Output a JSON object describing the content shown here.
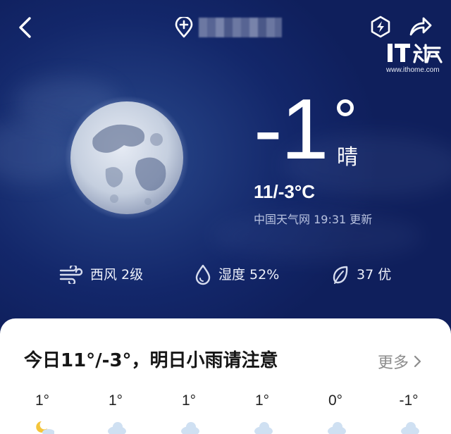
{
  "header": {
    "location_name": "███████",
    "location_redacted": true
  },
  "watermark": {
    "logo_text": "IT之家",
    "url": "www.ithome.com"
  },
  "current": {
    "temperature": "-1",
    "degree_symbol": "°",
    "condition": "晴",
    "range": "11/-3°C",
    "source": "中国天气网 19:31 更新",
    "moon_icon": "full-moon"
  },
  "stats": [
    {
      "icon": "wind-icon",
      "label": "西风 2级"
    },
    {
      "icon": "humidity-icon",
      "label": "湿度 52%"
    },
    {
      "icon": "leaf-icon",
      "label": "37 优"
    }
  ],
  "summary": {
    "headline": "今日11°/-3°，明日小雨请注意",
    "more_label": "更多"
  },
  "hourly": [
    {
      "temp": "1°",
      "icon": "moon-cloud-icon"
    },
    {
      "temp": "1°",
      "icon": "cloud-icon"
    },
    {
      "temp": "1°",
      "icon": "cloud-icon"
    },
    {
      "temp": "1°",
      "icon": "cloud-icon"
    },
    {
      "temp": "0°",
      "icon": "cloud-icon"
    },
    {
      "temp": "-1°",
      "icon": "cloud-icon"
    }
  ],
  "colors": {
    "sky_top": "#0f1f5c",
    "sky_glow": "#2a4a8c",
    "card_bg": "#ffffff",
    "muted_text": "#b9c3e0",
    "more_text": "#8c8c8c"
  }
}
